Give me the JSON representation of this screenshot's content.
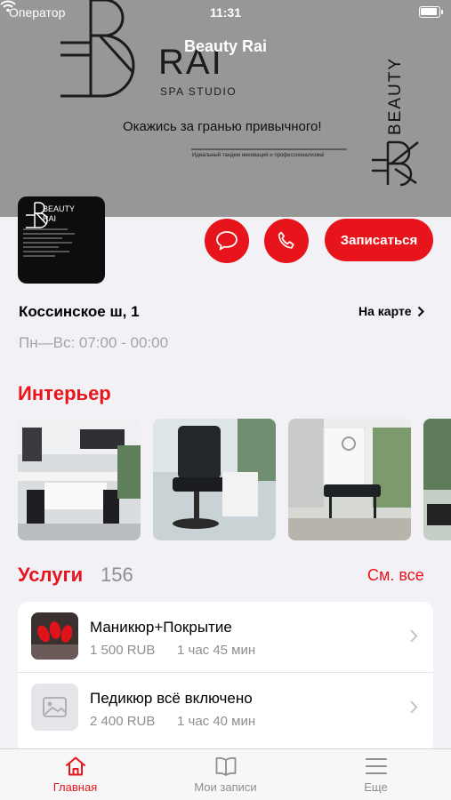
{
  "status_bar": {
    "carrier": "Оператор",
    "time": "11:31"
  },
  "header": {
    "title": "Beauty Rai",
    "brand_name": "RAI",
    "brand_sub": "SPA STUDIO",
    "slogan": "Окажись за гранью привычного!",
    "tagline": "Идеальный тандем инноваций и профессионализма!",
    "brand_vertical": "BEAUTY"
  },
  "profile": {
    "logo_text": "BEAUTY\nRAI"
  },
  "actions": {
    "book_label": "Записаться"
  },
  "location": {
    "address": "Коссинское ш, 1",
    "map_label": "На карте",
    "hours": "Пн—Вс: 07:00 - 00:00"
  },
  "interior": {
    "title": "Интерьер"
  },
  "services": {
    "title": "Услуги",
    "count": "156",
    "see_all": "См. все",
    "items": [
      {
        "name": "Маникюр+Покрытие",
        "price": "1 500 RUB",
        "duration": "1 час 45 мин"
      },
      {
        "name": "Педикюр всё включено",
        "price": "2 400 RUB",
        "duration": "1 час 40 мин"
      }
    ]
  },
  "tabbar": {
    "tabs": [
      {
        "label": "Главная",
        "icon": "home-icon",
        "active": true
      },
      {
        "label": "Мои записи",
        "icon": "book-icon",
        "active": false
      },
      {
        "label": "Еще",
        "icon": "menu-icon",
        "active": false
      }
    ]
  },
  "colors": {
    "accent": "#e8141c",
    "background": "#f2f2f6",
    "banner": "#979797"
  }
}
